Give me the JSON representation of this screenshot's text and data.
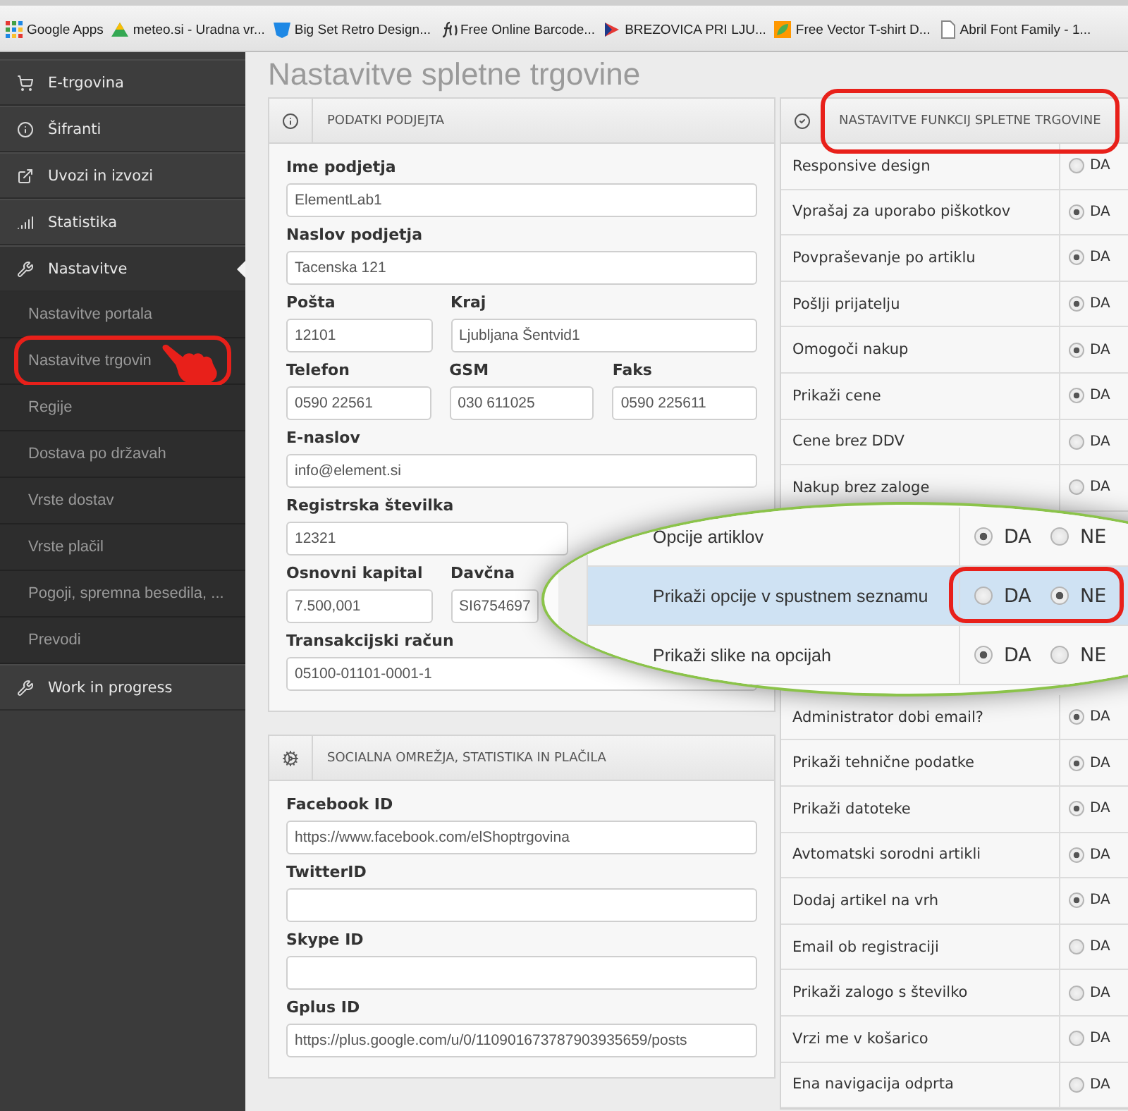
{
  "bookmarks": [
    {
      "kind": "apps",
      "label": "Google Apps"
    },
    {
      "kind": "drive",
      "label": "meteo.si - Uradna vr..."
    },
    {
      "kind": "shield",
      "label": "Big Set Retro Design..."
    },
    {
      "kind": "function",
      "label": "Free Online Barcode..."
    },
    {
      "kind": "flag",
      "label": "BREZOVICA PRI LJU..."
    },
    {
      "kind": "leaf",
      "label": "Free Vector T-shirt D..."
    },
    {
      "kind": "page",
      "label": "Abril Font Family - 1..."
    }
  ],
  "sidebar": {
    "items": [
      {
        "kind": "cart",
        "label": "E-trgovina",
        "selected": false
      },
      {
        "kind": "info",
        "label": "Šifranti",
        "selected": false
      },
      {
        "kind": "export",
        "label": "Uvozi in izvozi",
        "selected": false
      },
      {
        "kind": "bars",
        "label": "Statistika",
        "selected": false
      },
      {
        "kind": "wrench",
        "label": "Nastavitve",
        "selected": true,
        "children": [
          {
            "label": "Nastavitve portala"
          },
          {
            "label": "Nastavitve trgovin"
          },
          {
            "label": "Regije"
          },
          {
            "label": "Dostava po državah"
          },
          {
            "label": "Vrste dostav"
          },
          {
            "label": "Vrste plačil"
          },
          {
            "label": "Pogoji, spremna besedila, ..."
          },
          {
            "label": "Prevodi"
          }
        ]
      },
      {
        "kind": "wrench",
        "label": "Work in progress",
        "selected": false
      }
    ]
  },
  "page_title": "Nastavitve spletne trgovine",
  "left_panels": [
    {
      "kind": "info",
      "title": "PODATKI PODJEJTA",
      "rows": [
        {
          "fields": [
            {
              "label": "Ime podjetja",
              "value": "ElementLab1"
            }
          ]
        },
        {
          "fields": [
            {
              "label": "Naslov podjetja",
              "value": "Tacenska 121"
            }
          ]
        },
        {
          "fields": [
            {
              "label": "Pošta",
              "value": "12101"
            },
            {
              "label": "Kraj",
              "value": "Ljubljana Šentvid1"
            }
          ]
        },
        {
          "fields": [
            {
              "label": "Telefon",
              "value": "0590 22561"
            },
            {
              "label": "GSM",
              "value": "030 611025"
            },
            {
              "label": "Faks",
              "value": "0590 225611"
            }
          ]
        },
        {
          "fields": [
            {
              "label": "E-naslov",
              "value": "info@element.si"
            }
          ]
        },
        {
          "fields": [
            {
              "label": "Registrska številka",
              "value": "12321"
            }
          ]
        },
        {
          "fields": [
            {
              "label": "Osnovni kapital",
              "value": "7.500,001"
            },
            {
              "label": "Davčna",
              "value": "SI6754697"
            }
          ]
        },
        {
          "fields": [
            {
              "label": "Transakcijski račun",
              "value": "05100-01101-0001-1"
            }
          ]
        }
      ]
    },
    {
      "kind": "gear",
      "title": "SOCIALNA OMREŽJA, STATISTIKA IN PLAČILA",
      "rows": [
        {
          "fields": [
            {
              "label": "Facebook ID",
              "value": "https://www.facebook.com/elShoptrgovina"
            }
          ]
        },
        {
          "fields": [
            {
              "label": "TwitterID"
            }
          ]
        },
        {
          "fields": [
            {
              "label": "Skype ID"
            }
          ]
        },
        {
          "fields": [
            {
              "label": "Gplus ID",
              "value": "https://plus.google.com/u/0/110901673787903935659/posts"
            }
          ]
        }
      ]
    }
  ],
  "settings_panel": {
    "title": "NASTAVITVE FUNKCIJ SPLETNE TRGOVINE",
    "rows_top": [
      {
        "label": "Responsive design",
        "option": "DA",
        "checked": false
      },
      {
        "label": "Vprašaj za uporabo piškotkov",
        "option": "DA",
        "checked": true
      },
      {
        "label": "Povpraševanje po artiklu",
        "option": "DA",
        "checked": true
      },
      {
        "label": "Pošlji prijatelju",
        "option": "DA",
        "checked": true
      },
      {
        "label": "Omogoči nakup",
        "option": "DA",
        "checked": true
      },
      {
        "label": "Prikaži cene",
        "option": "DA",
        "checked": true
      },
      {
        "label": "Cene brez DDV",
        "option": "DA",
        "checked": false
      },
      {
        "label": "Nakup brez zaloge",
        "option": "DA",
        "checked": false
      }
    ],
    "rows_bottom": [
      {
        "label": "Administrator dobi email?",
        "option": "DA",
        "checked": true
      },
      {
        "label": "Prikaži tehnične podatke",
        "option": "DA",
        "checked": true
      },
      {
        "label": "Prikaži datoteke",
        "option": "DA",
        "checked": true
      },
      {
        "label": "Avtomatski sorodni artikli",
        "option": "DA",
        "checked": true
      },
      {
        "label": "Dodaj artikel na vrh",
        "option": "DA",
        "checked": true
      },
      {
        "label": "Email ob registraciji",
        "option": "DA",
        "checked": false
      },
      {
        "label": "Prikaži zalogo s številko",
        "option": "DA",
        "checked": false
      },
      {
        "label": "Vrzi me v košarico",
        "option": "DA",
        "checked": false
      },
      {
        "label": "Ena navigacija odprta",
        "option": "DA",
        "checked": false
      }
    ]
  },
  "magnifier": {
    "rows": [
      {
        "label": "Opcije artiklov",
        "selected": false,
        "options": [
          {
            "label": "DA",
            "checked": true
          },
          {
            "label": "NE",
            "checked": false
          }
        ]
      },
      {
        "label": "Prikaži opcije v spustnem seznamu",
        "selected": true,
        "options": [
          {
            "label": "DA",
            "checked": false
          },
          {
            "label": "NE",
            "checked": true
          }
        ]
      },
      {
        "label": "Prikaži slike na opcijah",
        "selected": false,
        "options": [
          {
            "label": "DA",
            "checked": true
          },
          {
            "label": "NE",
            "checked": false
          }
        ]
      }
    ]
  }
}
